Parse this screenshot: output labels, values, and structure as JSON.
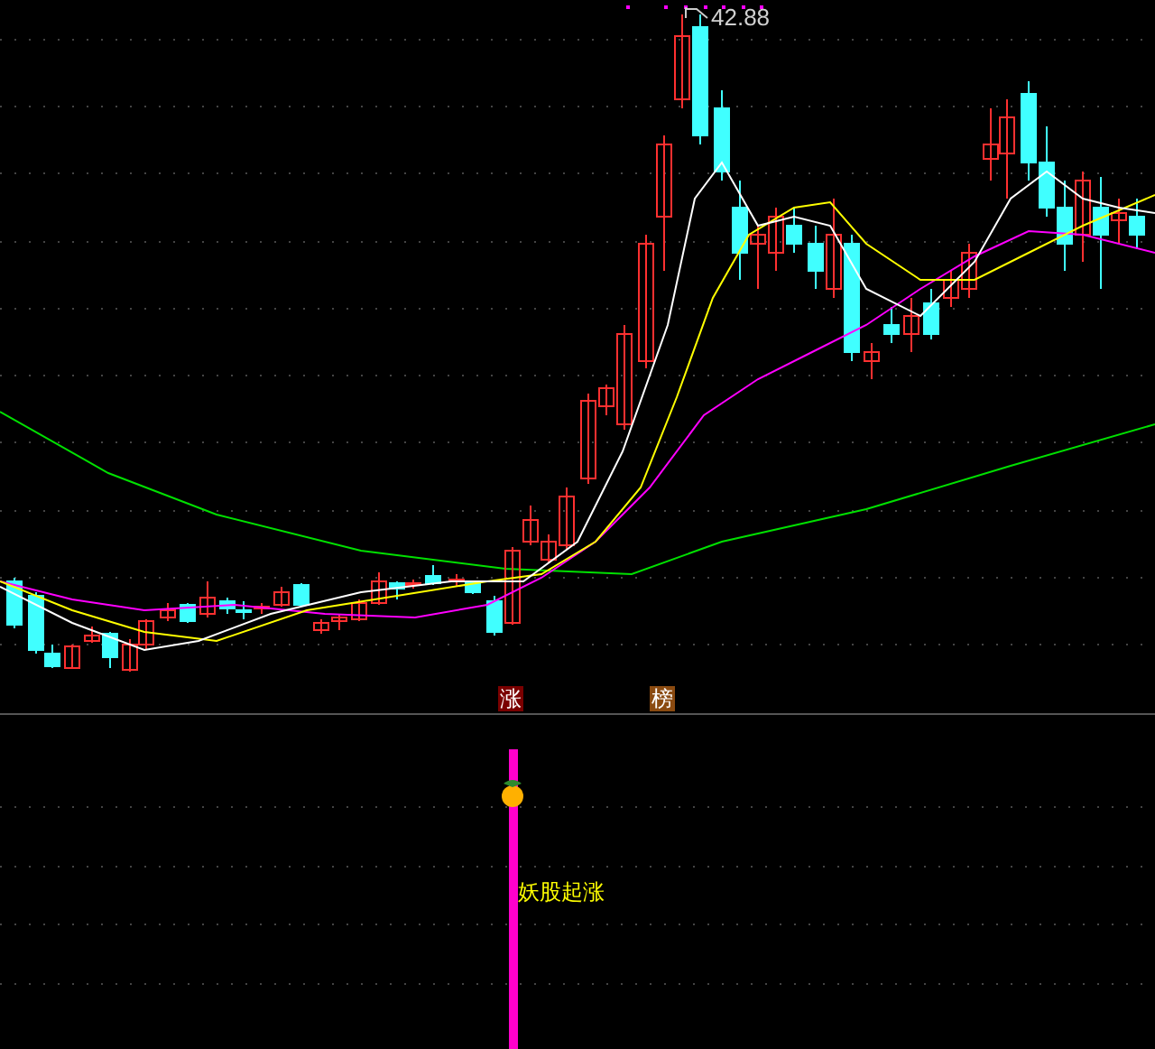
{
  "main_chart": {
    "high_label": "42.88"
  },
  "signal_markers": [
    {
      "text": "涨",
      "kind": "rise"
    },
    {
      "text": "榜",
      "kind": "rank"
    }
  ],
  "indicator_panel": {
    "signal_text": "妖股起涨"
  }
}
